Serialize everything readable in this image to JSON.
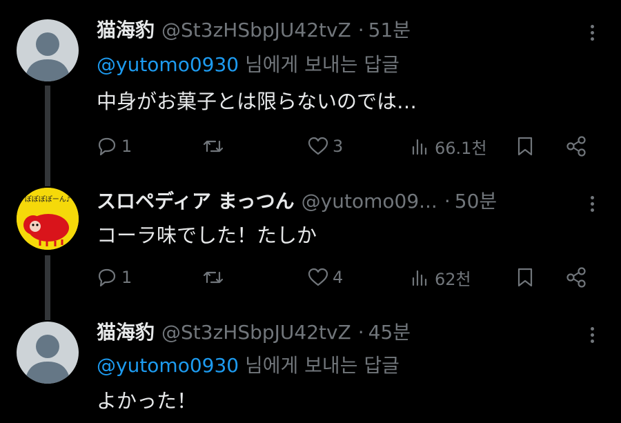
{
  "tweets": [
    {
      "display_name": "猫海豹",
      "handle": "@St3zHSbpJU42tvZ",
      "separator": "·",
      "time": "51분",
      "reply_mention": "@yutomo0930",
      "reply_suffix": " 님에게 보내는 답글",
      "text": "中身がお菓子とは限らないのでは…",
      "metrics": {
        "replies": "1",
        "retweets": "",
        "likes": "3",
        "views": "66.1천"
      }
    },
    {
      "display_name": "スロペディア まっつん",
      "handle": "@yutomo09...",
      "separator": "·",
      "time": "50분",
      "text": "コーラ味でした！たしか",
      "avatar_text": "ぽぽぽぽーん♪",
      "metrics": {
        "replies": "1",
        "retweets": "",
        "likes": "4",
        "views": "62천"
      }
    },
    {
      "display_name": "猫海豹",
      "handle": "@St3zHSbpJU42tvZ",
      "separator": "·",
      "time": "45분",
      "reply_mention": "@yutomo0930",
      "reply_suffix": " 님에게 보내는 답글",
      "text": "よかった！"
    }
  ],
  "icons": {
    "reply": "reply-icon",
    "retweet": "retweet-icon",
    "like": "heart-icon",
    "views": "views-icon",
    "bookmark": "bookmark-icon",
    "share": "share-icon",
    "more": "more-icon"
  },
  "colors": {
    "background": "#000000",
    "text": "#e7e9ea",
    "muted": "#71767b",
    "mention": "#1d9bf0",
    "avatar_default": "#cdd3d7",
    "avatar_silhouette": "#657786",
    "avatar2_bg": "#f5d90a",
    "avatar2_creature": "#d9141b"
  }
}
